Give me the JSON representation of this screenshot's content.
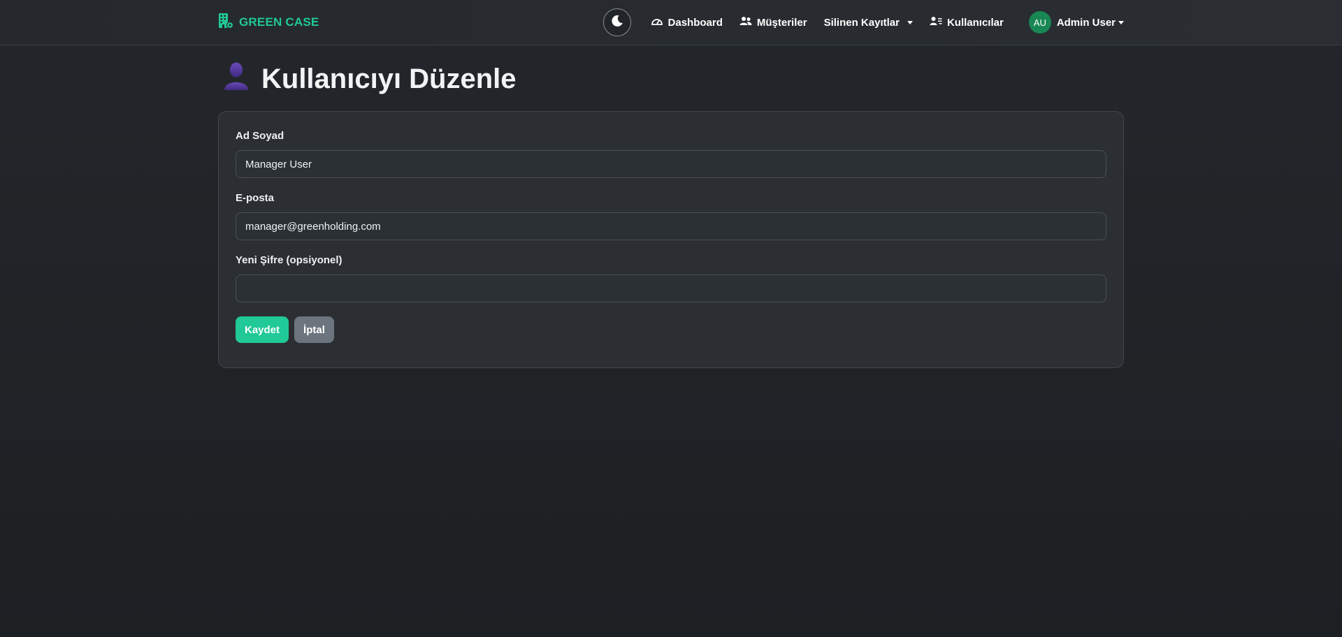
{
  "brand": {
    "name": "GREEN CASE"
  },
  "nav": {
    "dashboard": "Dashboard",
    "customers": "Müşteriler",
    "deleted_records": "Silinen Kayıtlar",
    "users": "Kullanıcılar"
  },
  "user": {
    "initials": "AU",
    "name": "Admin User"
  },
  "page": {
    "title": "Kullanıcıyı Düzenle"
  },
  "form": {
    "fullname_label": "Ad Soyad",
    "fullname_value": "Manager User",
    "email_label": "E-posta",
    "email_value": "manager@greenholding.com",
    "password_label": "Yeni Şifre (opsiyonel)",
    "password_value": "",
    "save_label": "Kaydet",
    "cancel_label": "İptal"
  },
  "colors": {
    "accent": "#20c997",
    "avatar": "#198754",
    "cancel": "#6c757d",
    "title_icon": "#4b2c8f"
  },
  "icons": {
    "brand": "building-gear-icon",
    "theme": "moon-icon",
    "dashboard": "speedometer-icon",
    "customers": "people-icon",
    "users": "person-lines-icon",
    "title": "user-silhouette-icon"
  }
}
